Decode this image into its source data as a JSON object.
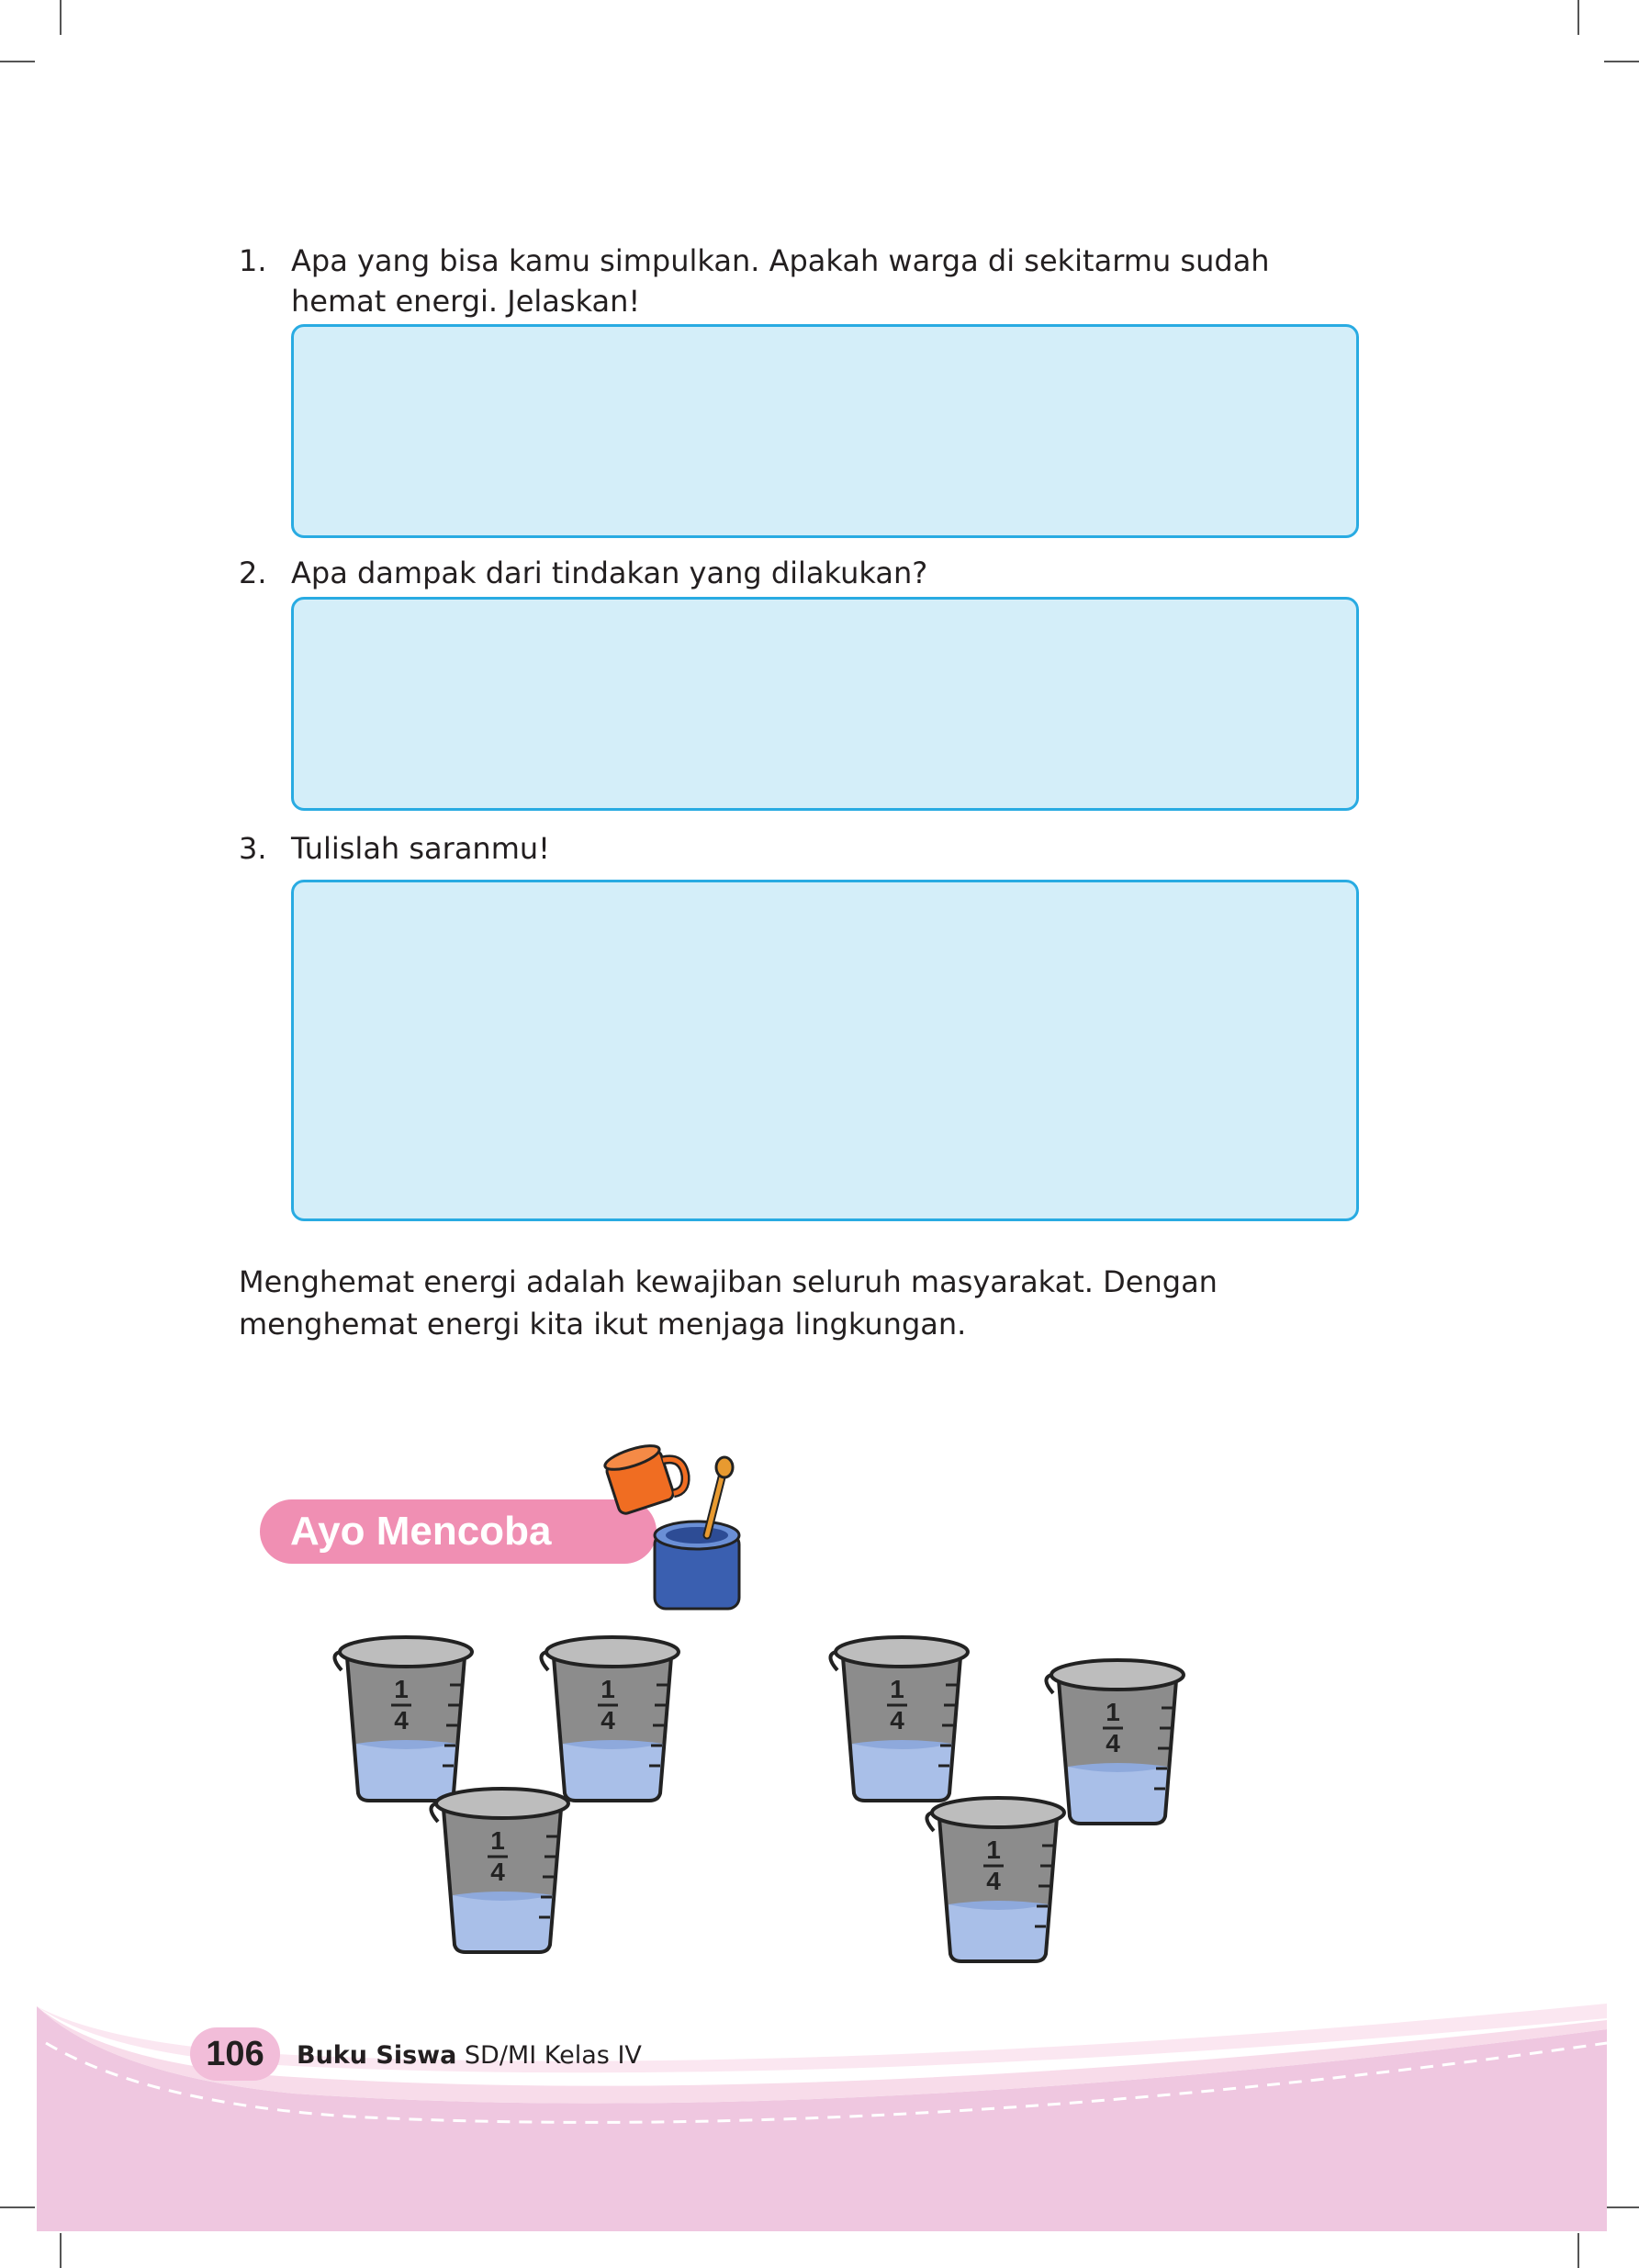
{
  "questions": [
    {
      "number": "1.",
      "text": "Apa yang bisa kamu simpulkan. Apakah warga di sekitarmu sudah hemat energi. Jelaskan!"
    },
    {
      "number": "2.",
      "text": "Apa dampak dari tindakan yang dilakukan?"
    },
    {
      "number": "3.",
      "text": "Tulislah saranmu!"
    }
  ],
  "closing_paragraph": "Menghemat energi adalah kewajiban seluruh masyarakat. Dengan menghemat energi kita ikut menjaga lingkungan.",
  "section": {
    "title": "Ayo Mencoba",
    "beaker_labels": [
      "1",
      "4",
      "1",
      "4",
      "1",
      "4",
      "1",
      "4",
      "1",
      "4",
      "1",
      "4"
    ]
  },
  "footer": {
    "page_number": "106",
    "book_title_bold": "Buku Siswa",
    "book_title_rest": " SD/MI Kelas IV"
  },
  "colors": {
    "answer_box_fill": "#d4eef9",
    "answer_box_border": "#29abe2",
    "heading_pill": "#f08fb3",
    "footer_pink": "#efc7e0"
  }
}
